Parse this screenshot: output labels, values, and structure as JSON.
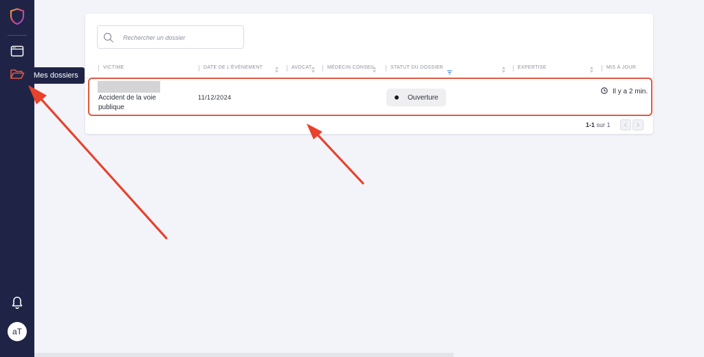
{
  "sidebar": {
    "logo_icon": "shield-logo-icon",
    "items": [
      {
        "icon": "window-icon"
      },
      {
        "icon": "folder-icon",
        "active": true,
        "tooltip": "Mes dossiers"
      }
    ],
    "bell_icon": "bell-icon",
    "avatar_initials": "aT"
  },
  "search": {
    "placeholder": "Rechercher un dossier"
  },
  "table": {
    "columns": [
      {
        "label": "Victime"
      },
      {
        "label": "Date de l'évènement",
        "sortable": true
      },
      {
        "label": "Avocat",
        "sortable": true
      },
      {
        "label": "Médecin conseil",
        "sortable": true
      },
      {
        "label": "Statut du dossier",
        "filtered": true,
        "sortable": true
      },
      {
        "label": "Expertise",
        "sortable": true
      },
      {
        "label": "Mis à jour"
      }
    ],
    "rows": [
      {
        "victim_name": "",
        "subject": "Accident de la voie publique",
        "date": "11/12/2024",
        "avocat": "",
        "medecin": "",
        "status": "Ouverture",
        "expertise": "",
        "updated": "Il y a 2 min."
      }
    ]
  },
  "pagination": {
    "range": "1-1",
    "sep": "sur",
    "total": "1"
  },
  "colors": {
    "sidebar": "#1f2447",
    "accent": "#e25741",
    "background": "#f3f4f9"
  }
}
